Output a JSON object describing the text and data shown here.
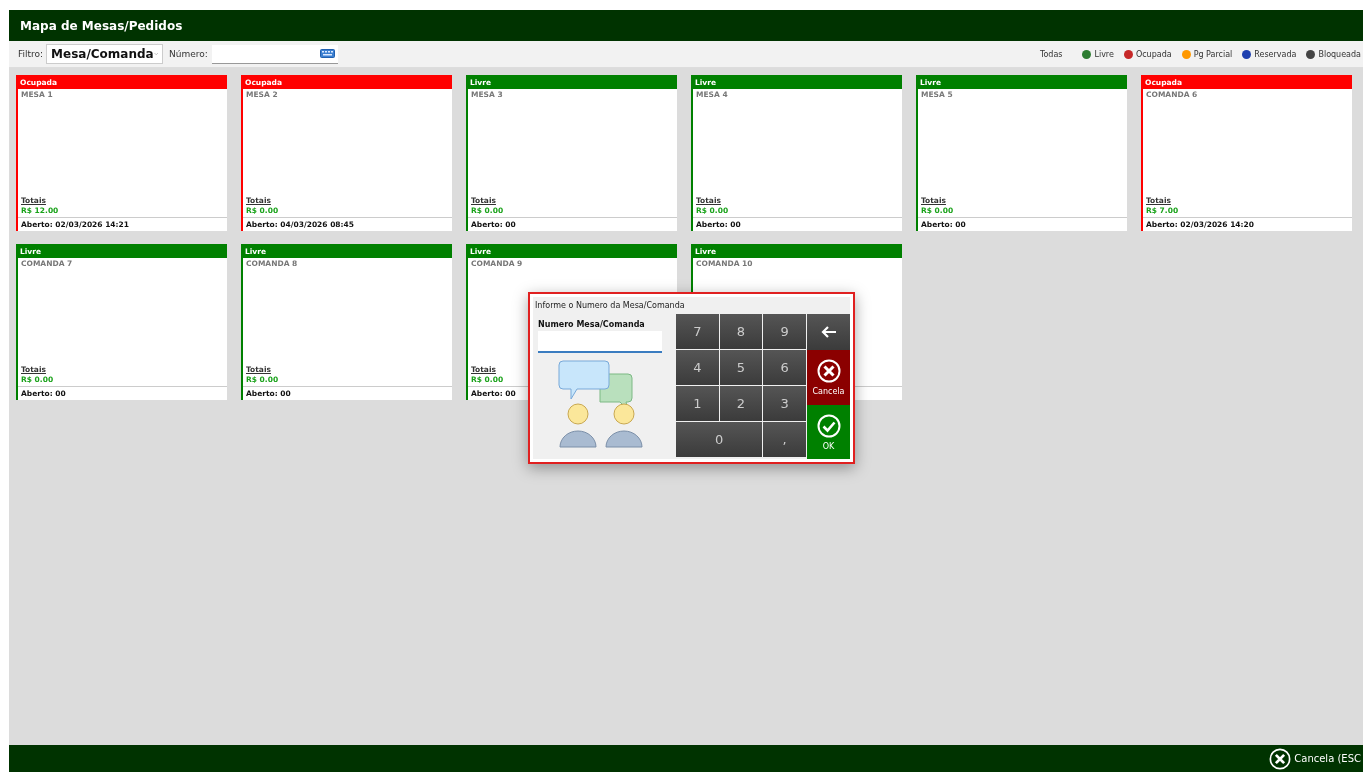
{
  "window": {
    "title": "Mapa de Mesas/Pedidos"
  },
  "toolbar": {
    "filter_label": "Filtro:",
    "filter_value": "Mesa/Comanda",
    "number_label": "Número:"
  },
  "legend": [
    {
      "label": "Todas",
      "kind": "all"
    },
    {
      "label": "Livre",
      "kind": "dot",
      "color": "#2e7d32"
    },
    {
      "label": "Ocupada",
      "kind": "dot",
      "color": "#c62828"
    },
    {
      "label": "Pg Parcial",
      "kind": "dot",
      "color": "#ff9800"
    },
    {
      "label": "Reservada",
      "kind": "dot",
      "color": "#1e40af"
    },
    {
      "label": "Bloqueada",
      "kind": "dot",
      "color": "#444444"
    }
  ],
  "tables": [
    {
      "status": "Ocupada",
      "kind": "ocupada",
      "name": "MESA 1",
      "totals_label": "Totais",
      "total": "R$ 12.00",
      "opened": "Aberto: 02/03/2026 14:21"
    },
    {
      "status": "Ocupada",
      "kind": "ocupada",
      "name": "MESA 2",
      "totals_label": "Totais",
      "total": "R$ 0.00",
      "opened": "Aberto: 04/03/2026 08:45"
    },
    {
      "status": "Livre",
      "kind": "livre",
      "name": "MESA 3",
      "totals_label": "Totais",
      "total": "R$ 0.00",
      "opened": "Aberto: 00"
    },
    {
      "status": "Livre",
      "kind": "livre",
      "name": "MESA 4",
      "totals_label": "Totais",
      "total": "R$ 0.00",
      "opened": "Aberto: 00"
    },
    {
      "status": "Livre",
      "kind": "livre",
      "name": "MESA 5",
      "totals_label": "Totais",
      "total": "R$ 0.00",
      "opened": "Aberto: 00"
    },
    {
      "status": "Ocupada",
      "kind": "ocupada",
      "name": "COMANDA 6",
      "totals_label": "Totais",
      "total": "R$ 7.00",
      "opened": "Aberto: 02/03/2026 14:20"
    },
    {
      "status": "Livre",
      "kind": "livre",
      "name": "COMANDA 7",
      "totals_label": "Totais",
      "total": "R$ 0.00",
      "opened": "Aberto: 00"
    },
    {
      "status": "Livre",
      "kind": "livre",
      "name": "COMANDA 8",
      "totals_label": "Totais",
      "total": "R$ 0.00",
      "opened": "Aberto: 00"
    },
    {
      "status": "Livre",
      "kind": "livre",
      "name": "COMANDA 9",
      "totals_label": "Totais",
      "total": "R$ 0.00",
      "opened": "Aberto: 00"
    },
    {
      "status": "Livre",
      "kind": "livre",
      "name": "COMANDA 10"
    }
  ],
  "dialog": {
    "title": "Informe o Numero da Mesa/Comanda",
    "field_label": "Numero Mesa/Comanda",
    "digits": [
      "7",
      "8",
      "9",
      "4",
      "5",
      "6",
      "1",
      "2",
      "3",
      "0",
      ","
    ],
    "actions": [
      {
        "kind": "back"
      },
      {
        "kind": "cancel",
        "label": "Cancela"
      },
      {
        "kind": "ok",
        "label": "OK"
      }
    ]
  },
  "footer": {
    "cancel_label": "Cancela (ESC"
  }
}
